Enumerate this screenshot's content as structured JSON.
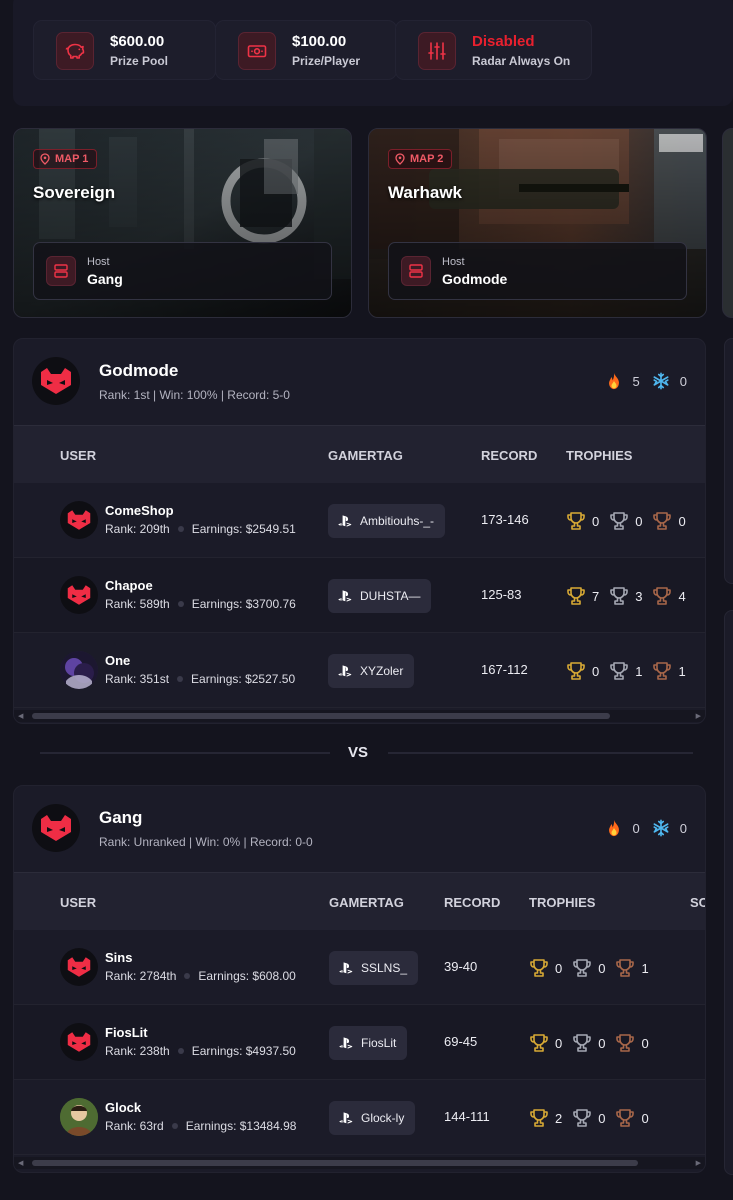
{
  "stats": [
    {
      "icon": "piggy-bank-icon",
      "value": "$600.00",
      "label": "Prize Pool",
      "red": false
    },
    {
      "icon": "cash-icon",
      "value": "$100.00",
      "label": "Prize/Player",
      "red": false
    },
    {
      "icon": "sliders-icon",
      "value": "Disabled",
      "label": "Radar Always On",
      "red": true
    }
  ],
  "maps": [
    {
      "badge": "MAP 1",
      "name": "Sovereign",
      "host_label": "Host",
      "host": "Gang"
    },
    {
      "badge": "MAP 2",
      "name": "Warhawk",
      "host_label": "Host",
      "host": "Godmode"
    }
  ],
  "headers": {
    "user": "USER",
    "gamertag": "GAMERTAG",
    "record": "RECORD",
    "trophies": "TROPHIES",
    "score_partial": "SC"
  },
  "vs": "VS",
  "teams": [
    {
      "name": "Godmode",
      "stats": "Rank: 1st | Win: 100% | Record: 5-0",
      "streak_hot": "5",
      "streak_cold": "0",
      "players": [
        {
          "name": "ComeShop",
          "rank": "Rank: 209th",
          "earnings": "Earnings: $2549.51",
          "gamertag": "Ambitiouhs-_-",
          "record": "173-146",
          "gold": "0",
          "silver": "0",
          "bronze": "0",
          "avatar": "logo"
        },
        {
          "name": "Chapoe",
          "rank": "Rank: 589th",
          "earnings": "Earnings: $3700.76",
          "gamertag": "DUHSTA—",
          "record": "125-83",
          "gold": "7",
          "silver": "3",
          "bronze": "4",
          "avatar": "logo"
        },
        {
          "name": "One",
          "rank": "Rank: 351st",
          "earnings": "Earnings: $2527.50",
          "gamertag": "XYZoler",
          "record": "167-112",
          "gold": "0",
          "silver": "1",
          "bronze": "1",
          "avatar": "photo-purple"
        }
      ]
    },
    {
      "name": "Gang",
      "stats": "Rank: Unranked | Win: 0% | Record: 0-0",
      "streak_hot": "0",
      "streak_cold": "0",
      "players": [
        {
          "name": "Sins",
          "rank": "Rank: 2784th",
          "earnings": "Earnings: $608.00",
          "gamertag": "SSLNS_",
          "record": "39-40",
          "gold": "0",
          "silver": "0",
          "bronze": "1",
          "avatar": "logo"
        },
        {
          "name": "FiosLit",
          "rank": "Rank: 238th",
          "earnings": "Earnings: $4937.50",
          "gamertag": "FiosLit",
          "record": "69-45",
          "gold": "0",
          "silver": "0",
          "bronze": "0",
          "avatar": "logo"
        },
        {
          "name": "Glock",
          "rank": "Rank: 63rd",
          "earnings": "Earnings: $13484.98",
          "gamertag": "Glock-ly",
          "record": "144-111",
          "gold": "2",
          "silver": "0",
          "bronze": "0",
          "avatar": "photo-green"
        }
      ]
    }
  ],
  "colors": {
    "accent": "#e8202e",
    "gold": "#d7a935",
    "silver": "#a5a8b3",
    "bronze": "#a8674a",
    "panel": "#1b1b28",
    "background": "#14141e"
  }
}
